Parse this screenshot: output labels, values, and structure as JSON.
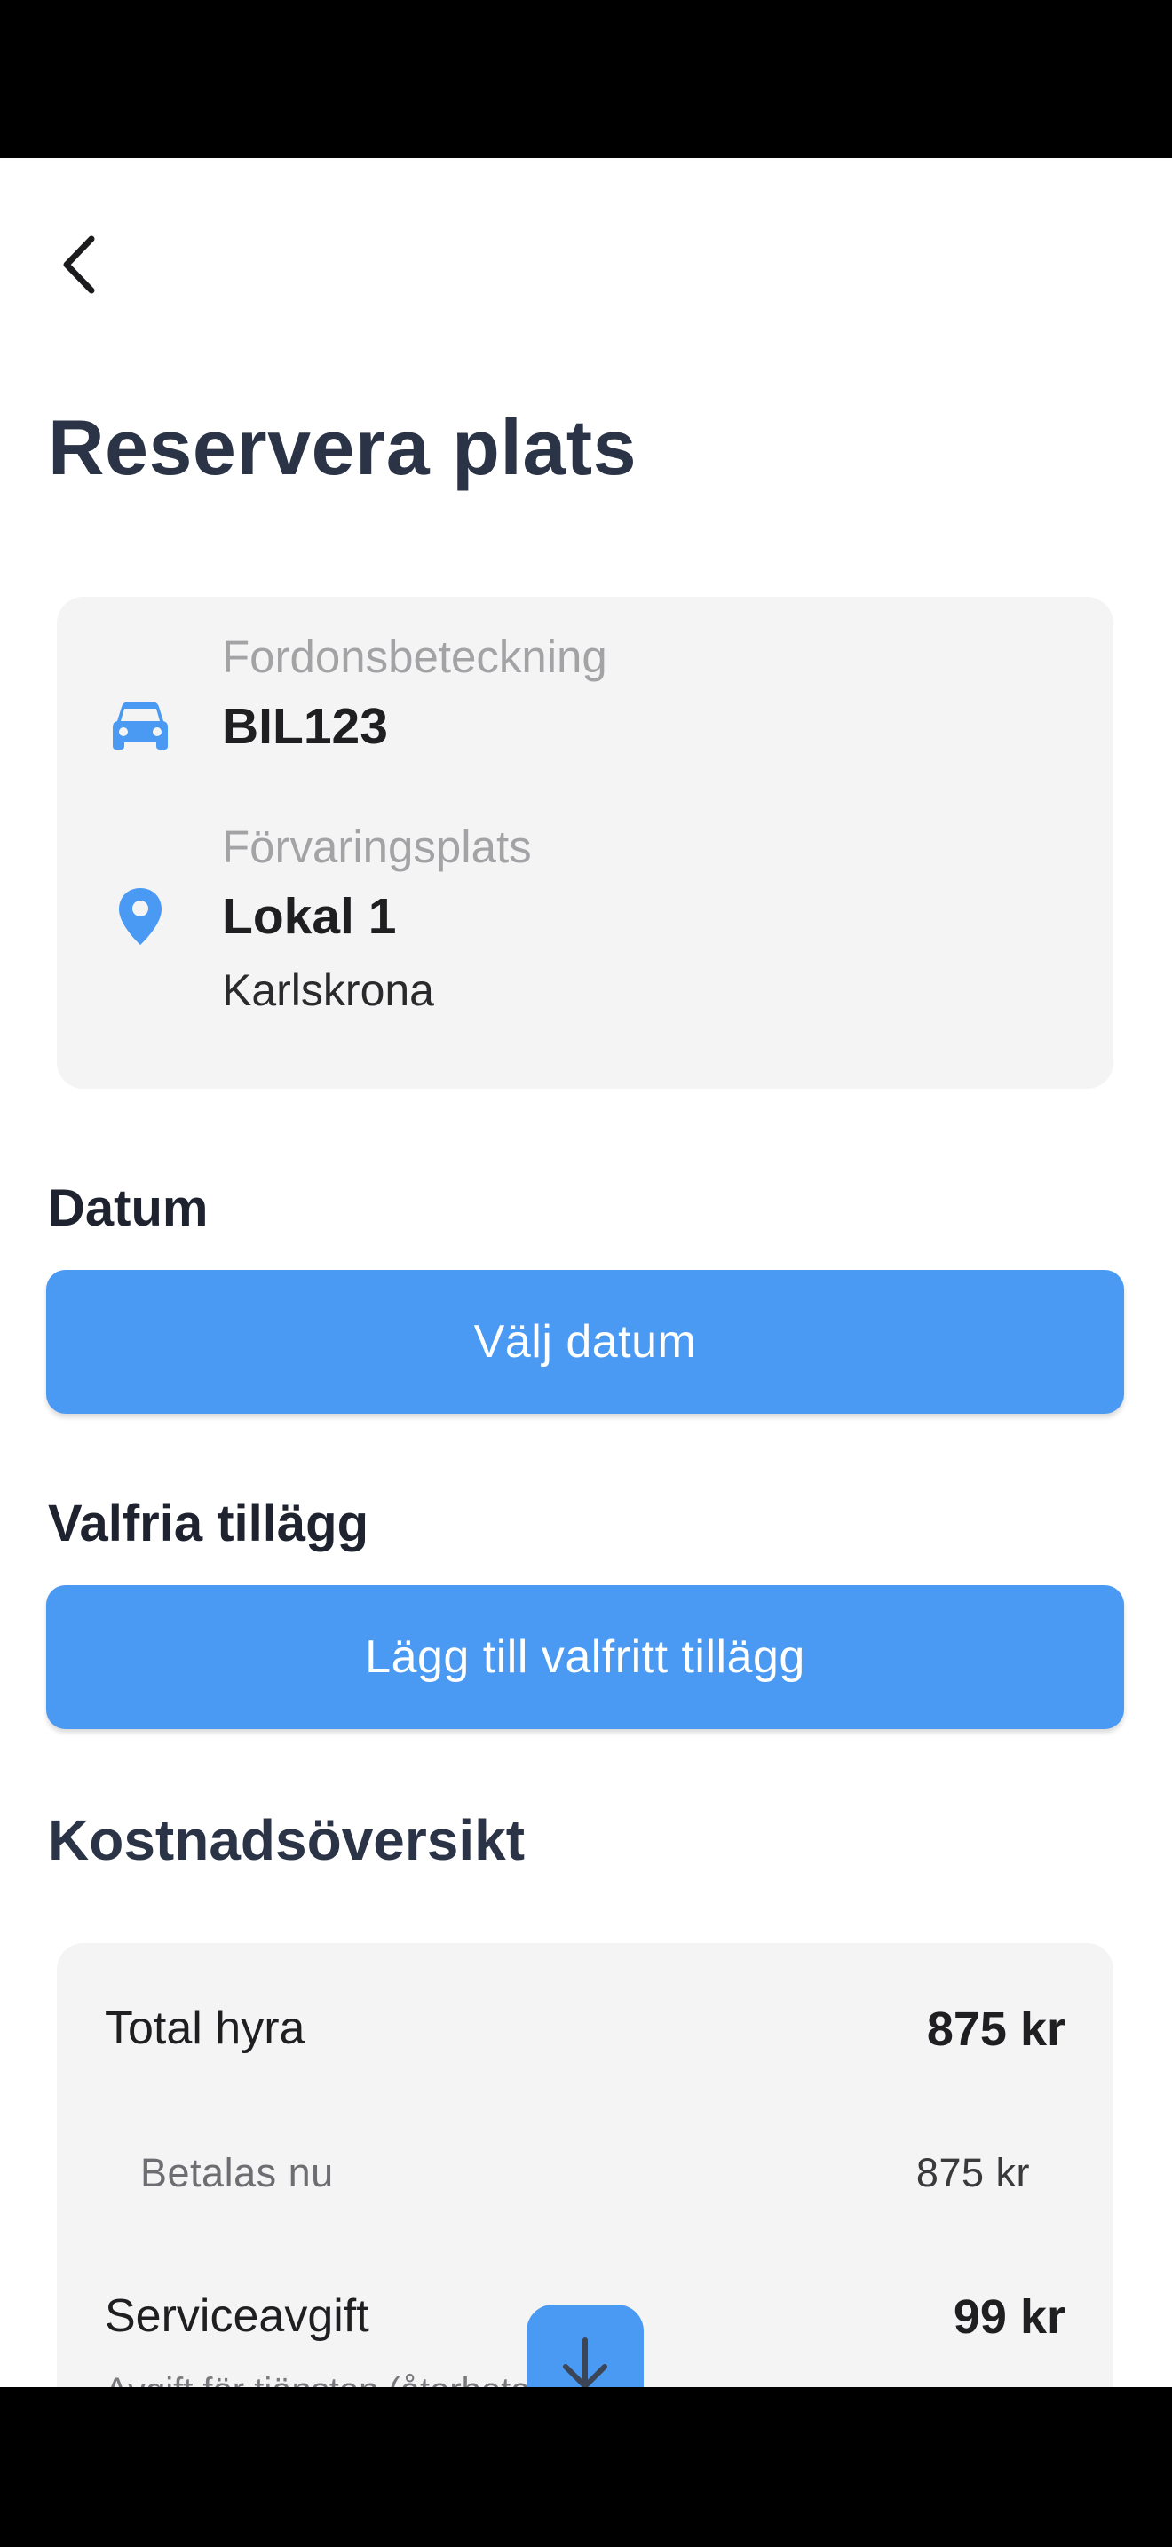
{
  "header": {
    "back_icon": "chevron-left-icon",
    "title": "Reservera plats"
  },
  "vehicle": {
    "icon": "car-icon",
    "label": "Fordonsbeteckning",
    "value": "BIL123"
  },
  "storage": {
    "icon": "location-pin-icon",
    "label": "Förvaringsplats",
    "value": "Lokal 1",
    "city": "Karlskrona"
  },
  "date_section": {
    "title": "Datum",
    "button_label": "Välj datum"
  },
  "addons_section": {
    "title": "Valfria tillägg",
    "button_label": "Lägg till valfritt tillägg"
  },
  "cost_section": {
    "title": "Kostnadsöversikt",
    "total_rent_label": "Total hyra",
    "total_rent_value": "875 kr",
    "pay_now_label": "Betalas nu",
    "pay_now_value": "875 kr",
    "service_fee_label": "Serviceavgift",
    "service_fee_value": "99 kr",
    "service_fee_note": "Avgift för tjänsten (återbetalas ej)"
  },
  "scroll_button_icon": "arrow-down-icon",
  "colors": {
    "accent": "#4a99f2",
    "title_text": "#2b3446",
    "card_background": "#f4f4f5"
  }
}
